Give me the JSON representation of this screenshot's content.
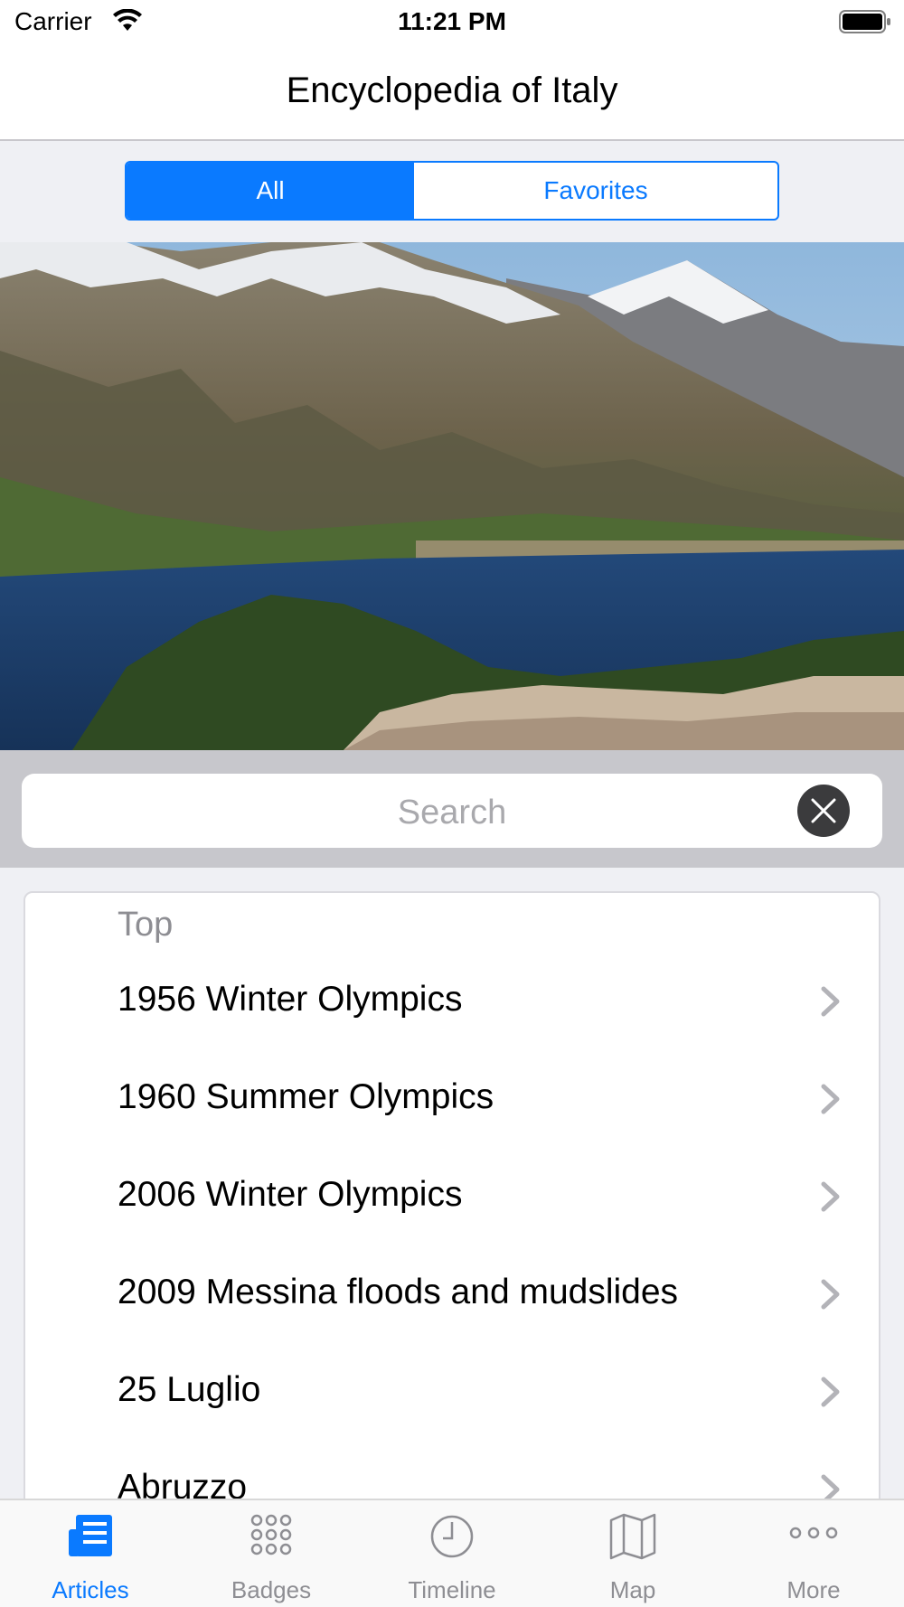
{
  "status_bar": {
    "carrier": "Carrier",
    "time": "11:21 PM"
  },
  "nav": {
    "title": "Encyclopedia of Italy"
  },
  "segments": {
    "options": [
      "All",
      "Favorites"
    ],
    "selected": "All"
  },
  "hero": {
    "icon": "lake-mountain-photo"
  },
  "search": {
    "placeholder": "Search",
    "clear_icon": "close-icon"
  },
  "list": {
    "section_header": "Top",
    "items": [
      "1956 Winter Olympics",
      "1960 Summer Olympics",
      "2006 Winter Olympics",
      "2009 Messina floods and mudslides",
      "25 Luglio",
      "Abruzzo"
    ]
  },
  "tab_bar": {
    "tabs": [
      {
        "label": "Articles",
        "icon": "newspaper-icon"
      },
      {
        "label": "Badges",
        "icon": "grid-dots-icon"
      },
      {
        "label": "Timeline",
        "icon": "clock-icon"
      },
      {
        "label": "Map",
        "icon": "map-icon"
      },
      {
        "label": "More",
        "icon": "ellipsis-icon"
      }
    ],
    "selected": "Articles"
  },
  "colors": {
    "accent": "#0a7aff",
    "search_bar_bg": "#c7c7cc",
    "grouped_bg": "#eff0f4"
  }
}
